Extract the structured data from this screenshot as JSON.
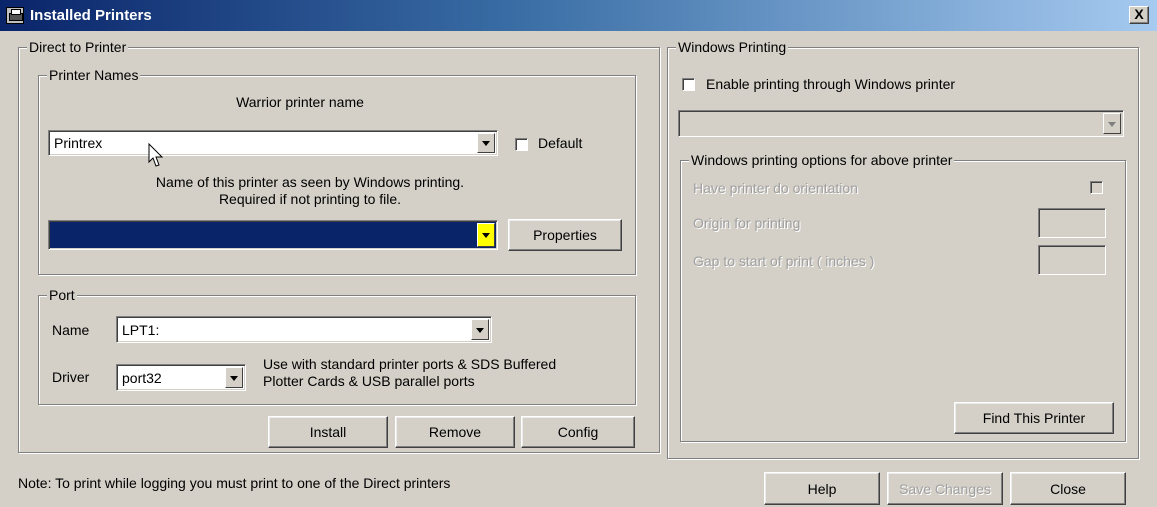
{
  "window": {
    "title": "Installed Printers",
    "close_glyph": "X"
  },
  "direct": {
    "group_label": "Direct to Printer",
    "printer_names": {
      "group_label": "Printer Names",
      "warrior_label": "Warrior printer name",
      "printer_value": "Printrex",
      "default_label": "Default",
      "windows_name_hint_line1": "Name of this printer as seen by Windows printing.",
      "windows_name_hint_line2": "Required if not printing to file.",
      "windows_printer_value": "",
      "properties_label": "Properties"
    },
    "port": {
      "group_label": "Port",
      "name_label": "Name",
      "name_value": "LPT1:",
      "driver_label": "Driver",
      "driver_value": "port32",
      "driver_hint_line1": "Use with standard printer ports & SDS Buffered",
      "driver_hint_line2": "Plotter Cards & USB parallel ports"
    },
    "buttons": {
      "install": "Install",
      "remove": "Remove",
      "config": "Config"
    }
  },
  "windows_printing": {
    "group_label": "Windows Printing",
    "enable_label": "Enable printing through Windows printer",
    "enable_checked": false,
    "printer_select_value": "",
    "options": {
      "group_label": "Windows printing options for above printer",
      "orientation_label": "Have printer do orientation",
      "origin_label": "Origin for printing",
      "gap_label": "Gap to start of print ( inches )"
    },
    "find_button": "Find This Printer"
  },
  "footer": {
    "note": "Note:  To print while logging you must print to one of the Direct printers",
    "help": "Help",
    "save": "Save Changes",
    "close": "Close"
  },
  "colors": {
    "dialog_bg": "#d4d0c8",
    "title_gradient_start": "#0a246a",
    "title_gradient_end": "#a6caf0",
    "selected_field": "#0a246a",
    "highlight_dropdown": "#ffff00"
  },
  "icons": {
    "app": "printer-icon",
    "close": "close-icon",
    "dropdown": "chevron-down-icon",
    "cursor": "mouse-cursor-icon"
  }
}
